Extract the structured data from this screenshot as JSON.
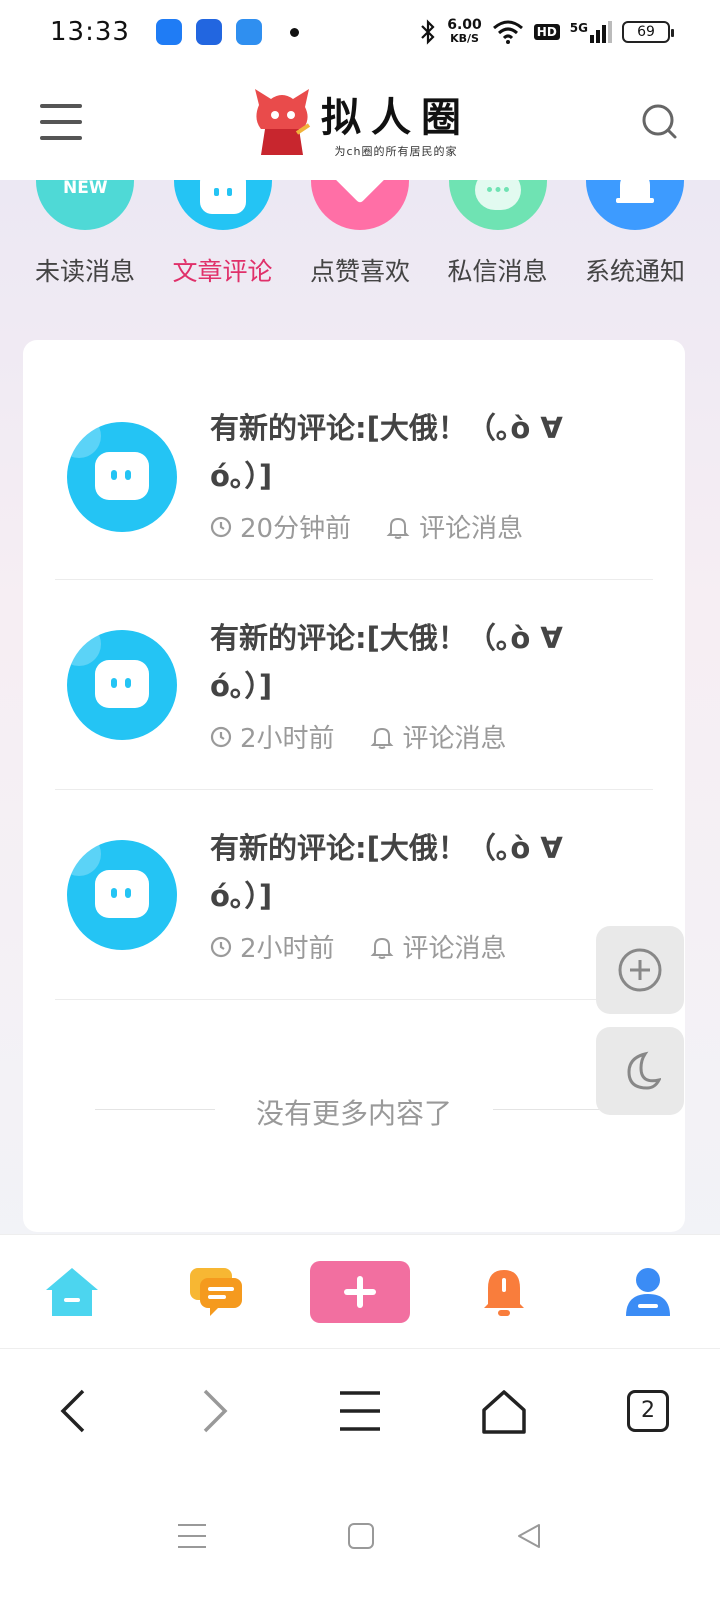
{
  "status_bar": {
    "time": "13:33",
    "net_speed_value": "6.00",
    "net_speed_unit": "KB/S",
    "hd": "HD",
    "signal": "5G",
    "battery": "69"
  },
  "header": {
    "logo_title": "拟人圈",
    "logo_subtitle": "为ch圈的所有居民的家"
  },
  "categories": [
    {
      "label": "未读消息",
      "color": "#4fd9d6",
      "icon": "new-icon",
      "badge": "NEW"
    },
    {
      "label": "文章评论",
      "color": "#24c4f4",
      "icon": "comment-bubble-icon",
      "active": true
    },
    {
      "label": "点赞喜欢",
      "color": "#ff6fa6",
      "icon": "heart-icon"
    },
    {
      "label": "私信消息",
      "color": "#5ee2a4",
      "icon": "chat-icon"
    },
    {
      "label": "系统通知",
      "color": "#3d9bff",
      "icon": "bell-icon"
    }
  ],
  "messages": [
    {
      "title": "有新的评论:[大俄！（｡ò ∀ ó｡）]",
      "time": "20分钟前",
      "type": "评论消息"
    },
    {
      "title": "有新的评论:[大俄！（｡ò ∀ ó｡）]",
      "time": "2小时前",
      "type": "评论消息"
    },
    {
      "title": "有新的评论:[大俄！（｡ò ∀ ó｡）]",
      "time": "2小时前",
      "type": "评论消息"
    }
  ],
  "list_footer": "没有更多内容了",
  "tab_bar": {
    "items": [
      "home-icon",
      "messages-icon",
      "add-icon",
      "notification-icon",
      "profile-icon"
    ]
  },
  "browser_bar": {
    "tab_count": "2"
  },
  "colors": {
    "accent_pink": "#e0306a",
    "comment_blue": "#24c4f4"
  }
}
